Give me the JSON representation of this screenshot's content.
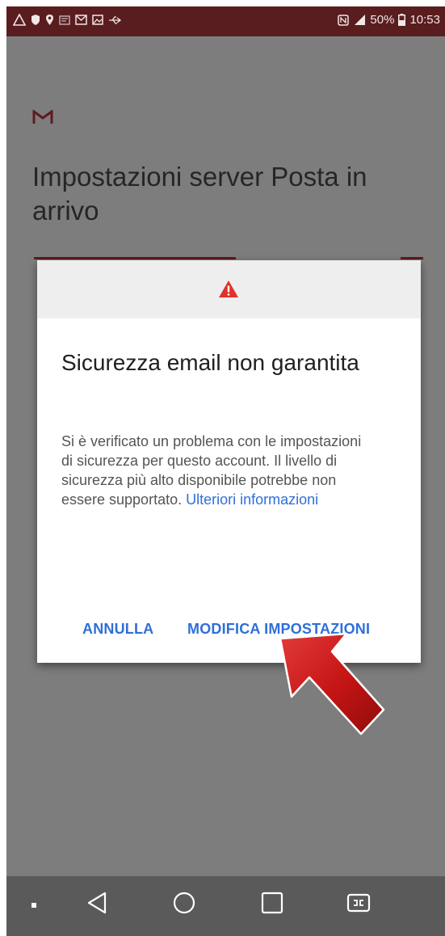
{
  "status_bar": {
    "battery": "50%",
    "time": "10:53",
    "left_icons": [
      "warning-icon",
      "shield-icon",
      "location-icon",
      "message-icon",
      "gmail-notification-icon",
      "image-icon",
      "usb-icon"
    ],
    "right_icons": [
      "nfc-icon",
      "signal-icon",
      "battery-icon"
    ]
  },
  "screen": {
    "title": "Impostazioni server Posta in arrivo"
  },
  "dialog": {
    "title": "Sicurezza email non garantita",
    "body": "Si è verificato un problema con le impostazioni di sicurezza per questo account. Il livello di sicurezza più alto disponibile potrebbe non essere supportato.",
    "link": "Ulteriori informazioni",
    "cancel_label": "ANNULLA",
    "modify_label": "MODIFICA IMPOSTAZIONI"
  },
  "nav_bar": {
    "items": [
      "dot-icon",
      "back-icon",
      "home-icon",
      "recents-icon",
      "dual-window-icon"
    ]
  },
  "colors": {
    "status_bar": "#5a1d1f",
    "accent_blue": "#2f6fd6",
    "warning_red": "#e0322d",
    "scrim": "#7d7d7d",
    "arrow_red": "#cc1b1b"
  }
}
